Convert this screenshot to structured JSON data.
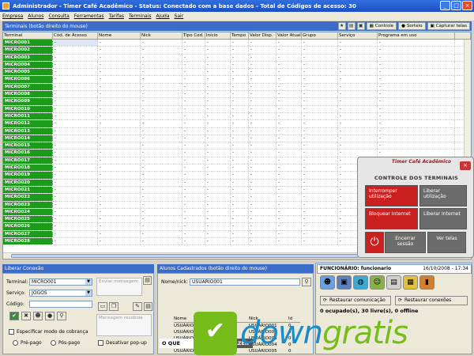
{
  "window": {
    "title": "Administrador - Timer Café Acadêmico - Status: Conectado com a base dados - Total de Códigos de acesso: 30",
    "min": "_",
    "max": "□",
    "close": "×"
  },
  "menu": [
    "Empresa",
    "Alunos",
    "Consulta",
    "Ferramentas",
    "Tarifas",
    "Terminais",
    "Ajuda",
    "Sair"
  ],
  "terminals_panel": {
    "title": "Terminais (botão direito do mouse)",
    "controle_label": "Controle",
    "sorteio_label": "Sorteio",
    "capturar_label": "Capturar telas"
  },
  "grid": {
    "columns": [
      "Terminal",
      "Cód. de Acesso",
      "Nome",
      "Nick",
      "Tipo Cod.",
      "Início",
      "Tempo",
      "Valor Disp.",
      "Valor Atual",
      "Grupo",
      "Serviço",
      "Programa em uso",
      ""
    ],
    "rows": [
      "MICRO001",
      "MICRO002",
      "MICRO003",
      "MICRO004",
      "MICRO005",
      "MICRO006",
      "MICRO007",
      "MICRO008",
      "MICRO009",
      "MICRO010",
      "MICRO011",
      "MICRO012",
      "MICRO013",
      "MICRO014",
      "MICRO015",
      "MICRO016",
      "MICRO017",
      "MICRO018",
      "MICRO019",
      "MICRO020",
      "MICRO021",
      "MICRO022",
      "MICRO023",
      "MICRO024",
      "MICRO025",
      "MICRO026",
      "MICRO027",
      "MICRO028"
    ],
    "cell_placeholder": "-"
  },
  "control": {
    "brand": "Timer Café Acadêmico",
    "title": "CONTROLE DOS TERMINAIS",
    "close": "×",
    "interromper": "Interromper utilização",
    "liberar_utilizacao": "Liberar utilização",
    "bloquear": "Bloquear Internet",
    "liberar_internet": "Liberar Internet",
    "encerrar": "Encerrar sessão",
    "ver_telas": "Ver telas",
    "power": "⏻"
  },
  "liberar": {
    "title": "Liberar Conexão",
    "terminal_label": "Terminal:",
    "terminal_value": "MICRO001",
    "servico_label": "Serviço:",
    "servico_value": "JOGOS",
    "codigo_label": "Código:",
    "codigo_value": "",
    "enviar_placeholder": "Enviar mensagem",
    "recebida_placeholder": "Mensagem recebida",
    "especificar": "Especificar modo de cobrança",
    "prepago": "Pré-pago",
    "pospago": "Pós-pago",
    "desativar": "Desativar pop-up"
  },
  "alunos": {
    "title": "Alunos Cadastrados (botão direito do mouse)",
    "nome_label": "Nome/nick:",
    "nome_value": "USUARIO001",
    "cols": [
      "Nome",
      "Nick",
      "Id"
    ],
    "rows": [
      [
        "USUÁRIO001",
        "USUÁRIO001",
        "0"
      ],
      [
        "USUÁRIO002",
        "USUÁRIO002",
        "0"
      ],
      [
        "USUÁRIO003",
        "USUÁRIO003",
        "0"
      ],
      [
        "USUÁRIO004",
        "USUÁRIO004",
        "0"
      ],
      [
        "USUÁRIO005",
        "USUÁRIO005",
        "0"
      ]
    ],
    "oque": "O QUE",
    "fazer": "FAZER"
  },
  "funcionario": {
    "label": "FUNCIONÁRIO: funcionario",
    "datetime": "16/10/2008 - 17:34",
    "restaurar_com": "Restaurar comunicação",
    "restaurar_con": "Restaurar conexões",
    "status": "0 ocupado(s), 30 livre(s), 0 offline"
  },
  "watermark": {
    "badge": "✔",
    "brand_a": "down",
    "brand_b": "gratis"
  }
}
